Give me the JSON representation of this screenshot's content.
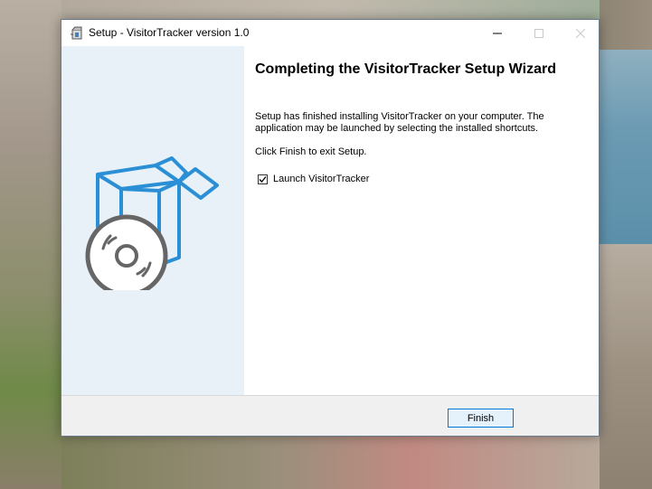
{
  "window": {
    "title": "Setup - VisitorTracker version 1.0",
    "controls": {
      "minimize_icon": "minimize-icon",
      "maximize_icon": "maximize-icon",
      "close_icon": "close-icon"
    }
  },
  "wizard": {
    "heading": "Completing the VisitorTracker Setup Wizard",
    "paragraph1": "Setup has finished installing VisitorTracker on your computer. The application may be launched by selecting the installed shortcuts.",
    "paragraph2": "Click Finish to exit Setup.",
    "launch_checkbox": {
      "label": "Launch VisitorTracker",
      "checked": true
    },
    "sidebar_graphic": "box-with-disc-icon"
  },
  "footer": {
    "finish_label": "Finish"
  },
  "colors": {
    "accent_blue": "#0078d7",
    "graphic_blue": "#2b8fd6",
    "sidebar_bg": "#e8f1f8",
    "footer_bg": "#f0f0f0"
  }
}
